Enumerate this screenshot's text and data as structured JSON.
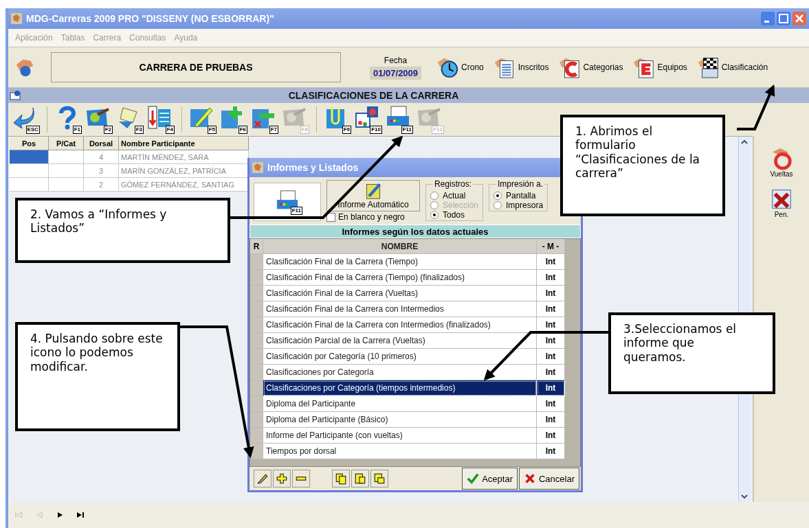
{
  "window": {
    "title": "MDG-Carreras 2009 PRO \"DISSENY (NO ESBORRAR)\""
  },
  "menu": [
    "Aplicación",
    "Tablas",
    "Carrera",
    "Consultas",
    "Ayuda"
  ],
  "header": {
    "race_name": "CARRERA DE PRUEBAS",
    "date_label": "Fecha",
    "date": "01/07/2009",
    "nav_buttons": [
      {
        "label": "Crono",
        "kind": "clock"
      },
      {
        "label": "Inscritos",
        "kind": "list"
      },
      {
        "label": "Categorias",
        "kind": "c"
      },
      {
        "label": "Equipos",
        "kind": "e"
      },
      {
        "label": "Clasificación",
        "kind": "flag"
      }
    ]
  },
  "section_title": "CLASIFICACIONES DE LA CARRERA",
  "toolbar_groups": [
    [
      {
        "key": "ESC",
        "kind": "back",
        "disabled": false
      }
    ],
    [
      {
        "key": "F1",
        "kind": "help",
        "disabled": false
      },
      {
        "key": "F2",
        "kind": "map",
        "disabled": false
      },
      {
        "key": "F3",
        "kind": "notes",
        "disabled": false
      },
      {
        "key": "F4",
        "kind": "sort",
        "disabled": false
      }
    ],
    [
      {
        "key": "F5",
        "kind": "edit",
        "disabled": false
      },
      {
        "key": "F6",
        "kind": "add",
        "disabled": false
      },
      {
        "key": "F7",
        "kind": "remove",
        "disabled": false
      },
      {
        "key": "F8",
        "kind": "map",
        "disabled": true
      }
    ],
    [
      {
        "key": "F9",
        "kind": "clip",
        "disabled": false
      },
      {
        "key": "F10",
        "kind": "chart",
        "disabled": false
      },
      {
        "key": "F11",
        "kind": "print",
        "disabled": false
      },
      {
        "key": "F12",
        "kind": "map",
        "disabled": true
      }
    ]
  ],
  "grid": {
    "columns": [
      "Pos",
      "P/Cat",
      "Dorsal",
      "Nombre Participante"
    ],
    "rows": [
      {
        "pos": "",
        "pcat": "",
        "dorsal": "4",
        "name": "MARTÍN MÉNDEZ, SARA",
        "selected": true
      },
      {
        "pos": "",
        "pcat": "",
        "dorsal": "3",
        "name": "MARÍN GONZÁLEZ, PATRÍCIA",
        "selected": false
      },
      {
        "pos": "",
        "pcat": "",
        "dorsal": "2",
        "name": "GÓMEZ FERNÁNDEZ, SANTIAG",
        "selected": false
      }
    ]
  },
  "side_buttons": [
    {
      "label": "Vueltas",
      "kind": "laps"
    },
    {
      "label": "Pen.",
      "kind": "penalty"
    }
  ],
  "dialog": {
    "title": "Informes y Listados",
    "print_key": "F11",
    "auto_button": "Informe Automático",
    "bw_checkbox": {
      "label": "En blanco y negro",
      "checked": false
    },
    "registros": {
      "label": "Registros:",
      "options": [
        {
          "label": "Actual",
          "selected": false,
          "disabled": false
        },
        {
          "label": "Selección",
          "selected": false,
          "disabled": true
        },
        {
          "label": "Todos",
          "selected": true,
          "disabled": false
        }
      ]
    },
    "impresion": {
      "label": "Impresión a.",
      "options": [
        {
          "label": "Pantalla",
          "selected": true,
          "disabled": false
        },
        {
          "label": "Impresora",
          "selected": false,
          "disabled": false
        }
      ]
    },
    "section_title": "Informes según los datos actuales",
    "columns": [
      "R",
      "NOMBRE",
      "- M -"
    ],
    "rows": [
      {
        "name": "Clasificación Final de la Carrera (Tiempo)",
        "m": "Int",
        "selected": false
      },
      {
        "name": "Clasificación Final de la Carrera (Tiempo) (finalizados)",
        "m": "Int",
        "selected": false
      },
      {
        "name": "Clasificación Final de la Carrera (Vueltas)",
        "m": "Int",
        "selected": false
      },
      {
        "name": "Clasificación Final de la Carrera con Intermedios",
        "m": "Int",
        "selected": false
      },
      {
        "name": "Clasificación Final de la Carrera con Intermedios (finalizados)",
        "m": "Int",
        "selected": false
      },
      {
        "name": "Clasificación Parcial de la Carrera (Vueltas)",
        "m": "Int",
        "selected": false
      },
      {
        "name": "Clasificación por Categoría (10 primeros)",
        "m": "Int",
        "selected": false
      },
      {
        "name": "Clasificaciones por Categoría",
        "m": "Int",
        "selected": false
      },
      {
        "name": "Clasificaciones por Categoría (tiempos intermedios)",
        "m": "Int",
        "selected": true
      },
      {
        "name": "Diploma del Participante",
        "m": "Int",
        "selected": false
      },
      {
        "name": "Diploma del Participante (Básico)",
        "m": "Int",
        "selected": false
      },
      {
        "name": "Informe del Participante (con vueltas)",
        "m": "Int",
        "selected": false
      },
      {
        "name": "Tiempos por dorsal",
        "m": "Int",
        "selected": false
      }
    ],
    "accept": "Aceptar",
    "cancel": "Cancelar"
  },
  "annotations": [
    {
      "text": "1. Abrimos el formulario “Clasificaciones de la carrera”"
    },
    {
      "text": "2. Vamos a “Informes y Listados”"
    },
    {
      "text": "3.Seleccionamos el informe que queramos."
    },
    {
      "text": "4. Pulsando sobre este icono lo podemos modificar."
    }
  ]
}
